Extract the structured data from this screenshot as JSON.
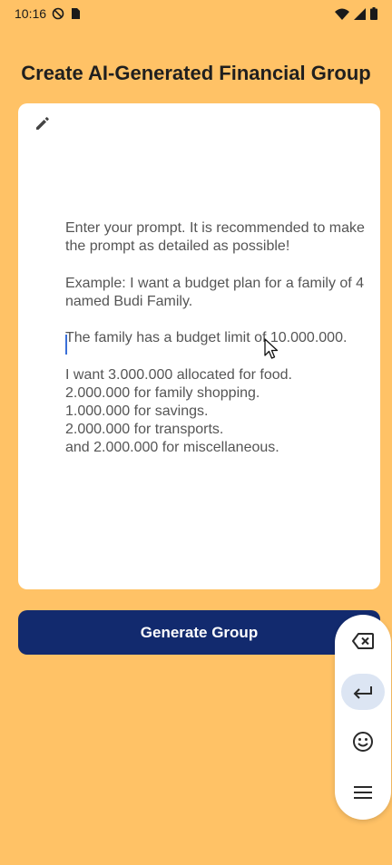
{
  "status_bar": {
    "time": "10:16"
  },
  "page": {
    "title": "Create AI-Generated Financial Group"
  },
  "prompt": {
    "text": "Enter your prompt. It is recommended to make the prompt as detailed as possible!\n\nExample: I want a budget plan for a family of 4 named Budi Family.\n\nThe family has a budget limit of 10.000.000.\n\nI want 3.000.000 allocated for food.\n2.000.000 for family shopping.\n1.000.000 for savings.\n2.000.000 for transports.\nand 2.000.000 for miscellaneous."
  },
  "actions": {
    "generate_label": "Generate Group"
  },
  "icons": {
    "status": [
      "vpn-icon",
      "sd-card-icon",
      "wifi-icon",
      "signal-icon",
      "battery-icon"
    ],
    "card": "edit-icon",
    "toolbar": [
      "backspace-icon",
      "enter-icon",
      "emoji-icon",
      "menu-icon"
    ]
  },
  "colors": {
    "background": "#FFC266",
    "card": "#FFFFFF",
    "primary": "#122A6E",
    "toolbar_active": "#DCE5F3"
  }
}
